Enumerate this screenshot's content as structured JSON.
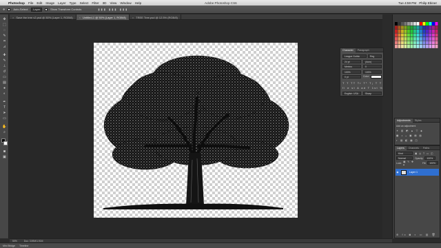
{
  "menubar": {
    "app": "Photoshop",
    "items": [
      "File",
      "Edit",
      "Image",
      "Layer",
      "Type",
      "Select",
      "Filter",
      "3D",
      "View",
      "Window",
      "Help"
    ],
    "window_title": "Adobe Photoshop CS6",
    "clock": "Tue 4:59 PM",
    "user": "Philip Ebiner"
  },
  "options": {
    "auto_select": "Auto-Select:",
    "auto_select_value": "Layer",
    "show_transform": "Show Transform Controls"
  },
  "tabs": [
    {
      "label": "Save the tree v2.psd @ 50% (Layer 1, RGB/8)"
    },
    {
      "label": "Untitled-1 @ 50% (Layer 1, RGB/8)"
    },
    {
      "label": "TREE Tree.psd @ 12.5% (RGB/8)"
    }
  ],
  "character": {
    "tabs": [
      "Character",
      "Paragraph"
    ],
    "font_family": "League Gothic",
    "font_style": "Reg",
    "size": "24 pt",
    "leading": "(Auto)",
    "kerning": "Metrics",
    "tracking": "0",
    "vscale": "100%",
    "hscale": "100%",
    "baseline": "0 pt",
    "color_label": "Color:",
    "language": "English: USA",
    "aa": "Sharp"
  },
  "adjustments": {
    "tabs": [
      "Adjustments",
      "Styles"
    ],
    "add_label": "Add an adjustment"
  },
  "layers": {
    "tabs": [
      "Layers",
      "Channels",
      "Paths"
    ],
    "kind": "Kind",
    "blend": "Normal",
    "opacity_label": "Opacity:",
    "opacity": "100%",
    "lock_label": "Lock:",
    "fill_label": "Fill:",
    "fill": "100%",
    "layer_name": "Layer 1"
  },
  "status": {
    "zoom": "50%",
    "doc": "Doc: 3.59M/1.91M"
  },
  "bottom": {
    "items": [
      "Mini Bridge",
      "Timeline"
    ]
  },
  "colors": {
    "bg": "#2b2b2b",
    "panel": "#474747",
    "accent": "#2f6fd0"
  }
}
